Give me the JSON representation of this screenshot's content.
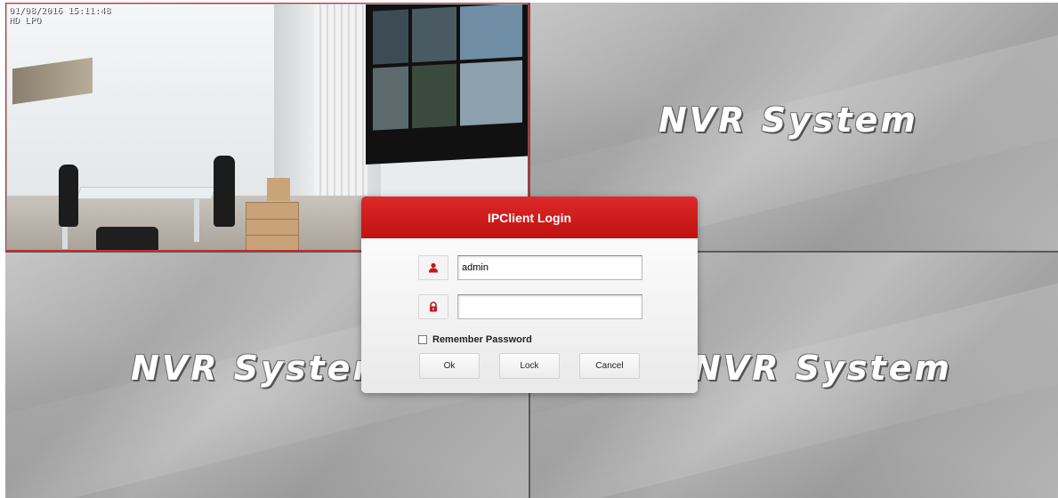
{
  "camera": {
    "timestamp": "01/08/2016 15:11:48",
    "quality": "HD LPO"
  },
  "tiles": {
    "brand_text": "NVR System"
  },
  "dialog": {
    "title": "IPClient Login",
    "username_value": "admin",
    "password_value": "",
    "remember_label": "Remember Password",
    "remember_checked": false,
    "buttons": {
      "ok": "Ok",
      "lock": "Lock",
      "cancel": "Cancel"
    },
    "icons": {
      "user": "user-icon",
      "lock": "padlock-icon"
    },
    "accent_color": "#c8151a"
  }
}
